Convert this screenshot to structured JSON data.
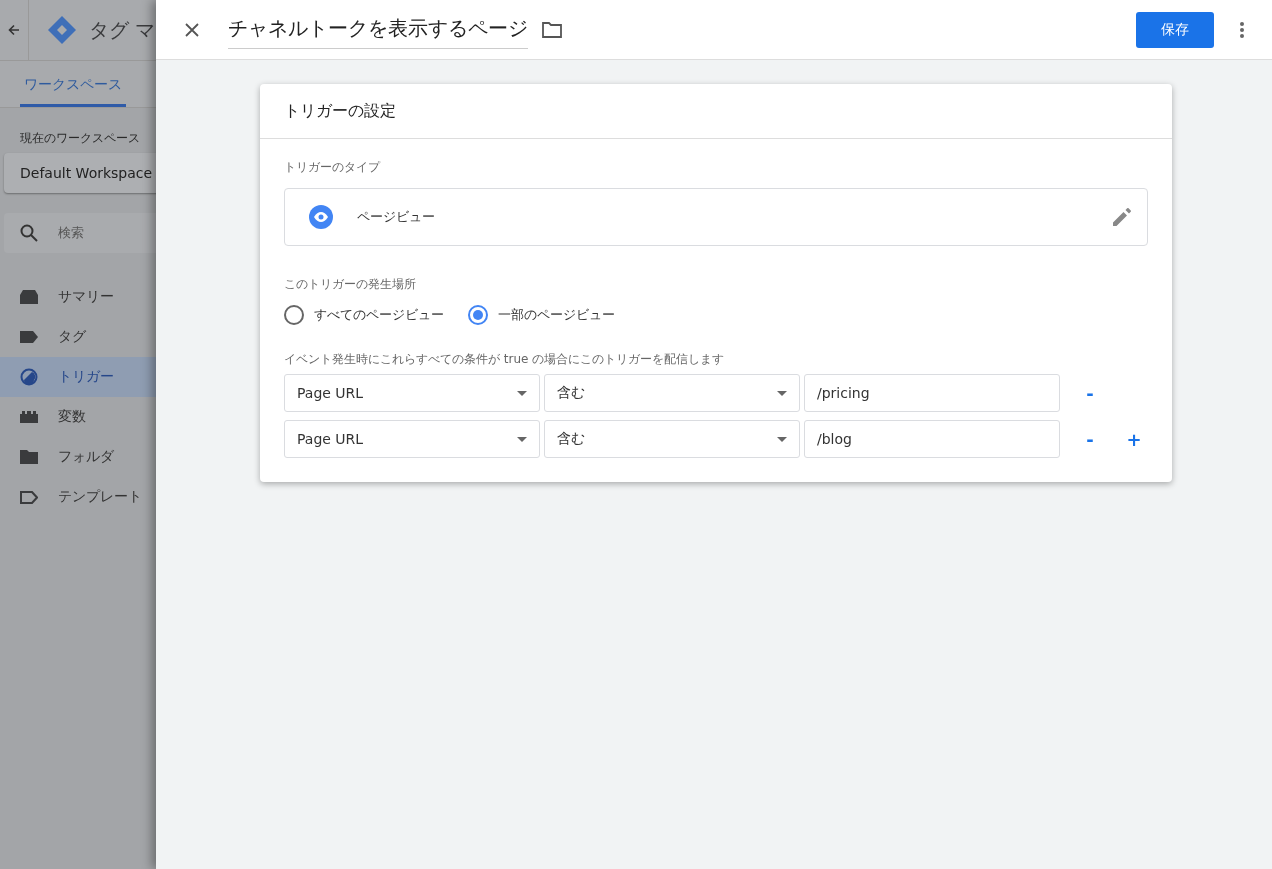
{
  "app": {
    "title": "タグ マ",
    "tabs": [
      {
        "label": "ワークスペース",
        "selected": true
      }
    ],
    "workspace_label": "現在のワークスペース",
    "workspace": "Default Workspace",
    "search": {
      "placeholder": "検索"
    },
    "nav": [
      {
        "label": "サマリー",
        "kind": "summary",
        "selected": false
      },
      {
        "label": "タグ",
        "kind": "tag",
        "selected": false
      },
      {
        "label": "トリガー",
        "kind": "trigger",
        "selected": true
      },
      {
        "label": "変数",
        "kind": "variable",
        "selected": false
      },
      {
        "label": "フォルダ",
        "kind": "folder",
        "selected": false
      },
      {
        "label": "テンプレート",
        "kind": "template",
        "selected": false
      }
    ]
  },
  "editor": {
    "name": "チャネルトークを表示するページ",
    "save": "保存",
    "card": {
      "title": "トリガーの設定",
      "type_label": "トリガーのタイプ",
      "type": "ページビュー",
      "scope_label": "このトリガーの発生場所",
      "scope_options": [
        {
          "label": "すべてのページビュー",
          "selected": false
        },
        {
          "label": "一部のページビュー",
          "selected": true
        }
      ],
      "conditions_label": "イベント発生時にこれらすべての条件が true の場合にこのトリガーを配信します",
      "conditions": [
        {
          "variable": "Page URL",
          "operator": "含む",
          "value": "/pricing",
          "buttons": [
            "-"
          ]
        },
        {
          "variable": "Page URL",
          "operator": "含む",
          "value": "/blog",
          "buttons": [
            "-",
            "+"
          ]
        }
      ]
    }
  }
}
